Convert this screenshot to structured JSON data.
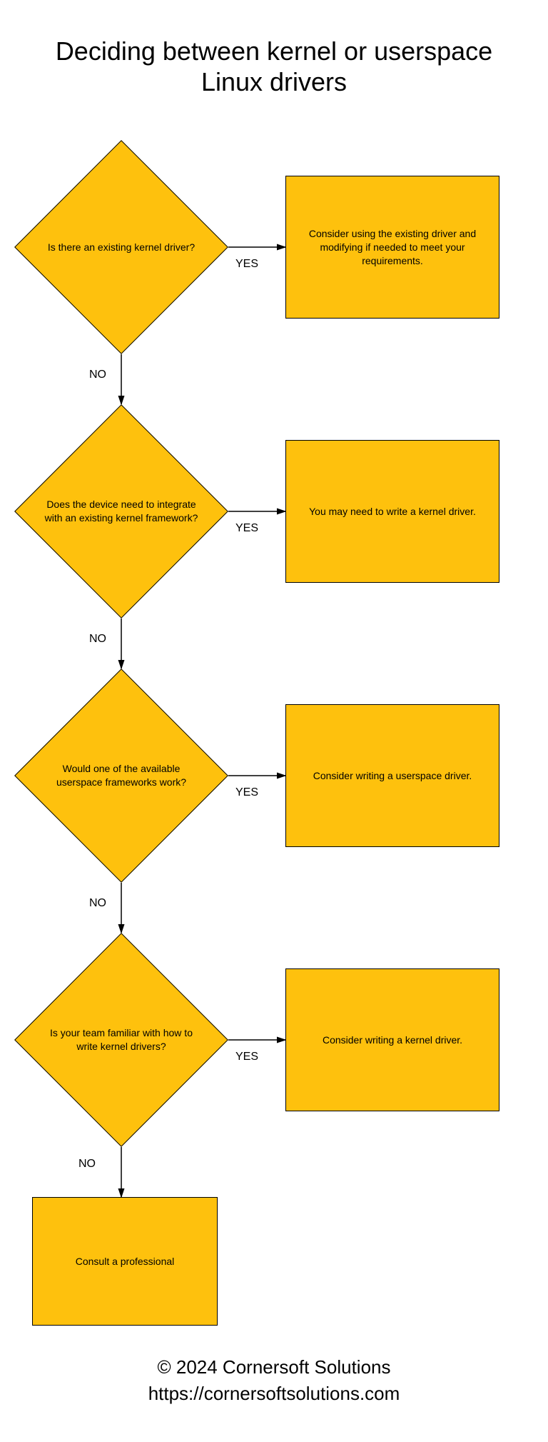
{
  "title": "Deciding between kernel or userspace Linux drivers",
  "labels": {
    "yes": "YES",
    "no": "NO"
  },
  "nodes": {
    "d1": "Is there an existing kernel driver?",
    "r1": "Consider using the existing driver and modifying if needed to meet your requirements.",
    "d2": "Does the device need to integrate with an existing kernel framework?",
    "r2": "You may need to write a kernel driver.",
    "d3": "Would one of the available userspace frameworks work?",
    "r3": "Consider writing a userspace driver.",
    "d4": "Is your team familiar with how to write kernel drivers?",
    "r4": "Consider writing a kernel driver.",
    "r5": "Consult a professional"
  },
  "footer": {
    "copyright": "© 2024 Cornersoft Solutions",
    "url": "https://cornersoftsolutions.com"
  },
  "colors": {
    "shape_fill": "#fec10d",
    "shape_stroke": "#000000"
  },
  "chart_data": {
    "type": "flowchart",
    "title": "Deciding between kernel or userspace Linux drivers",
    "nodes": [
      {
        "id": "d1",
        "shape": "decision",
        "text": "Is there an existing kernel driver?"
      },
      {
        "id": "r1",
        "shape": "process",
        "text": "Consider using the existing driver and modifying if needed to meet your requirements."
      },
      {
        "id": "d2",
        "shape": "decision",
        "text": "Does the device need to integrate with an existing kernel framework?"
      },
      {
        "id": "r2",
        "shape": "process",
        "text": "You may need to write a kernel driver."
      },
      {
        "id": "d3",
        "shape": "decision",
        "text": "Would one of the available userspace frameworks work?"
      },
      {
        "id": "r3",
        "shape": "process",
        "text": "Consider writing a userspace driver."
      },
      {
        "id": "d4",
        "shape": "decision",
        "text": "Is your team familiar with how to write kernel drivers?"
      },
      {
        "id": "r4",
        "shape": "process",
        "text": "Consider writing a kernel driver."
      },
      {
        "id": "r5",
        "shape": "process",
        "text": "Consult a professional"
      }
    ],
    "edges": [
      {
        "from": "d1",
        "to": "r1",
        "label": "YES"
      },
      {
        "from": "d1",
        "to": "d2",
        "label": "NO"
      },
      {
        "from": "d2",
        "to": "r2",
        "label": "YES"
      },
      {
        "from": "d2",
        "to": "d3",
        "label": "NO"
      },
      {
        "from": "d3",
        "to": "r3",
        "label": "YES"
      },
      {
        "from": "d3",
        "to": "d4",
        "label": "NO"
      },
      {
        "from": "d4",
        "to": "r4",
        "label": "YES"
      },
      {
        "from": "d4",
        "to": "r5",
        "label": "NO"
      }
    ]
  }
}
